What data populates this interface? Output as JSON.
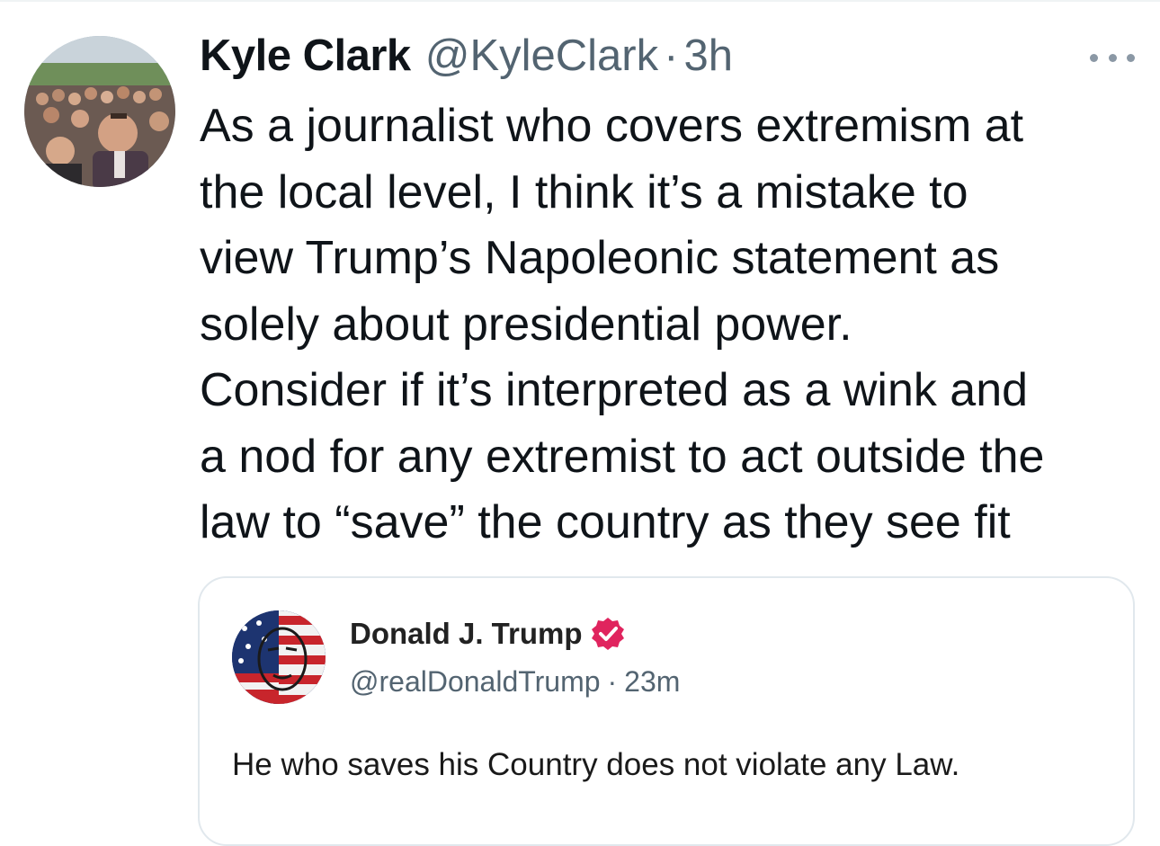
{
  "tweet": {
    "author": {
      "display_name": "Kyle Clark",
      "handle": "@KyleClark",
      "avatar_icon": "profile-photo-crowd-selfie"
    },
    "separator": "·",
    "time": "3h",
    "more_icon": "ellipsis-icon",
    "text": "As a journalist who covers extremism at\nthe local level, I think it’s a mistake to\nview Trump’s Napoleonic statement as\nsolely about presidential power.\nConsider if it’s interpreted as a wink and\na nod for any extremist to act outside the\nlaw to “save” the country as they see fit"
  },
  "quoted_post": {
    "author": {
      "display_name": "Donald J. Trump",
      "handle": "@realDonaldTrump",
      "verified_icon": "verified-badge-icon",
      "verified_color": "#e0245e",
      "avatar_icon": "flag-portrait-avatar"
    },
    "separator": "·",
    "time": "23m",
    "text": "He who saves his Country does not violate any Law."
  },
  "colors": {
    "text_primary": "#0f1419",
    "text_secondary": "#536471",
    "border": "#e1e8ed"
  }
}
